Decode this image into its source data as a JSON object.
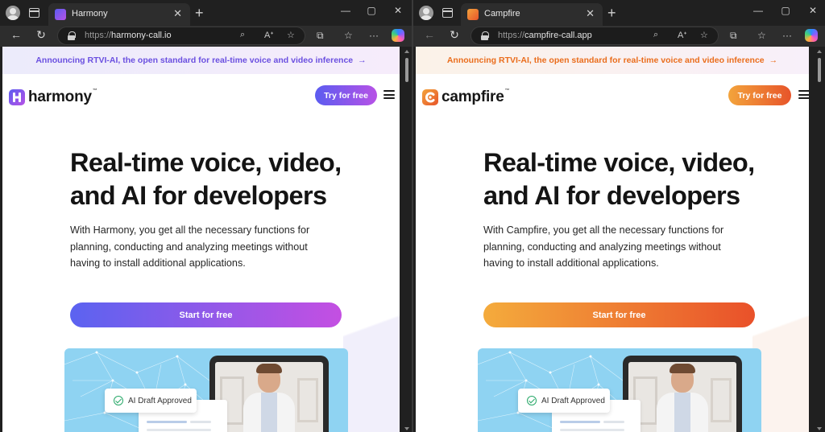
{
  "left": {
    "tab_title": "Harmony",
    "url_scheme": "https://",
    "url_host": "harmony-call.io",
    "banner": "Announcing RTVI-AI, the open standard for real-time voice and video inference",
    "brand": "harmony",
    "tm": "™",
    "try_label": "Try for free",
    "hero_title": "Real-time voice, video, and AI for developers",
    "hero_sub": "With Harmony, you get all the necessary functions for planning, conducting and analyzing meetings without having to install additional applications.",
    "start_label": "Start for free",
    "card_label": "AI Draft Approved",
    "accent_start": "#5b5cf0",
    "accent_end": "#b752e6"
  },
  "right": {
    "tab_title": "Campfire",
    "url_scheme": "https://",
    "url_host": "campfire-call.app",
    "banner": "Announcing RTVI-AI, the open standard for real-time voice and video inference",
    "brand": "campfire",
    "tm": "™",
    "try_label": "Try for free",
    "hero_title": "Real-time voice, video, and AI for developers",
    "hero_sub": "With Campfire, you get all the necessary functions for planning, conducting and analyzing meetings without having to install additional applications.",
    "start_label": "Start for free",
    "card_label": "AI Draft Approved",
    "accent_start": "#f3a43c",
    "accent_end": "#e7542a"
  },
  "chrome": {
    "banner_arrow": "→",
    "close_glyph": "✕",
    "newtab_glyph": "+",
    "back_glyph": "←",
    "reload_glyph": "↻",
    "minimize_glyph": "—",
    "maximize_glyph": "▢",
    "window_close_glyph": "✕",
    "zoom_glyph": "⌕",
    "readaloud_glyph": "Aᐩ",
    "favorite_glyph": "☆",
    "extensions_glyph": "⧉",
    "favorites_bar_glyph": "☆",
    "more_glyph": "···"
  }
}
